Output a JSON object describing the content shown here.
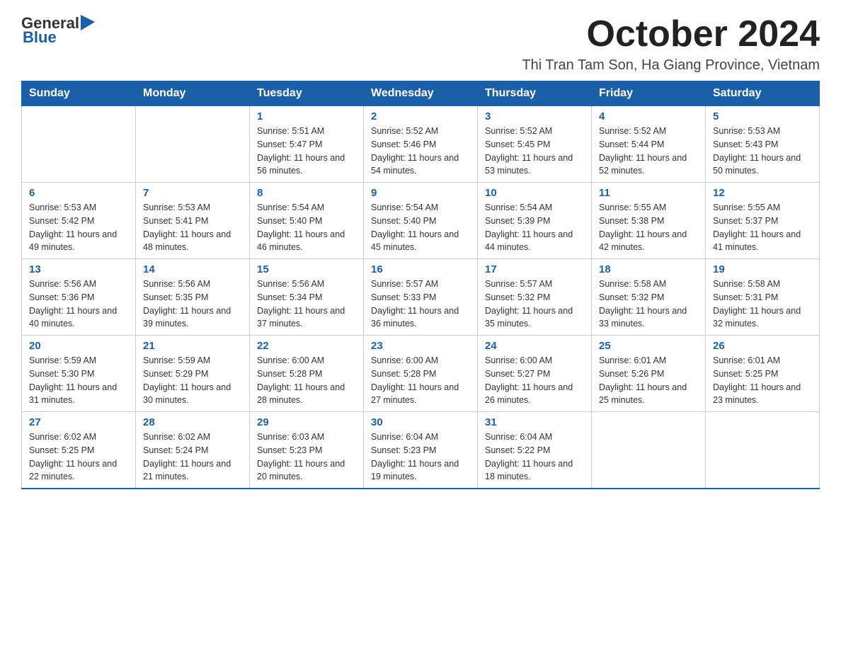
{
  "header": {
    "logo": {
      "general": "General",
      "blue": "Blue"
    },
    "title": "October 2024",
    "location": "Thi Tran Tam Son, Ha Giang Province, Vietnam"
  },
  "weekdays": [
    "Sunday",
    "Monday",
    "Tuesday",
    "Wednesday",
    "Thursday",
    "Friday",
    "Saturday"
  ],
  "weeks": [
    [
      {
        "day": "",
        "sunrise": "",
        "sunset": "",
        "daylight": ""
      },
      {
        "day": "",
        "sunrise": "",
        "sunset": "",
        "daylight": ""
      },
      {
        "day": "1",
        "sunrise": "Sunrise: 5:51 AM",
        "sunset": "Sunset: 5:47 PM",
        "daylight": "Daylight: 11 hours and 56 minutes."
      },
      {
        "day": "2",
        "sunrise": "Sunrise: 5:52 AM",
        "sunset": "Sunset: 5:46 PM",
        "daylight": "Daylight: 11 hours and 54 minutes."
      },
      {
        "day": "3",
        "sunrise": "Sunrise: 5:52 AM",
        "sunset": "Sunset: 5:45 PM",
        "daylight": "Daylight: 11 hours and 53 minutes."
      },
      {
        "day": "4",
        "sunrise": "Sunrise: 5:52 AM",
        "sunset": "Sunset: 5:44 PM",
        "daylight": "Daylight: 11 hours and 52 minutes."
      },
      {
        "day": "5",
        "sunrise": "Sunrise: 5:53 AM",
        "sunset": "Sunset: 5:43 PM",
        "daylight": "Daylight: 11 hours and 50 minutes."
      }
    ],
    [
      {
        "day": "6",
        "sunrise": "Sunrise: 5:53 AM",
        "sunset": "Sunset: 5:42 PM",
        "daylight": "Daylight: 11 hours and 49 minutes."
      },
      {
        "day": "7",
        "sunrise": "Sunrise: 5:53 AM",
        "sunset": "Sunset: 5:41 PM",
        "daylight": "Daylight: 11 hours and 48 minutes."
      },
      {
        "day": "8",
        "sunrise": "Sunrise: 5:54 AM",
        "sunset": "Sunset: 5:40 PM",
        "daylight": "Daylight: 11 hours and 46 minutes."
      },
      {
        "day": "9",
        "sunrise": "Sunrise: 5:54 AM",
        "sunset": "Sunset: 5:40 PM",
        "daylight": "Daylight: 11 hours and 45 minutes."
      },
      {
        "day": "10",
        "sunrise": "Sunrise: 5:54 AM",
        "sunset": "Sunset: 5:39 PM",
        "daylight": "Daylight: 11 hours and 44 minutes."
      },
      {
        "day": "11",
        "sunrise": "Sunrise: 5:55 AM",
        "sunset": "Sunset: 5:38 PM",
        "daylight": "Daylight: 11 hours and 42 minutes."
      },
      {
        "day": "12",
        "sunrise": "Sunrise: 5:55 AM",
        "sunset": "Sunset: 5:37 PM",
        "daylight": "Daylight: 11 hours and 41 minutes."
      }
    ],
    [
      {
        "day": "13",
        "sunrise": "Sunrise: 5:56 AM",
        "sunset": "Sunset: 5:36 PM",
        "daylight": "Daylight: 11 hours and 40 minutes."
      },
      {
        "day": "14",
        "sunrise": "Sunrise: 5:56 AM",
        "sunset": "Sunset: 5:35 PM",
        "daylight": "Daylight: 11 hours and 39 minutes."
      },
      {
        "day": "15",
        "sunrise": "Sunrise: 5:56 AM",
        "sunset": "Sunset: 5:34 PM",
        "daylight": "Daylight: 11 hours and 37 minutes."
      },
      {
        "day": "16",
        "sunrise": "Sunrise: 5:57 AM",
        "sunset": "Sunset: 5:33 PM",
        "daylight": "Daylight: 11 hours and 36 minutes."
      },
      {
        "day": "17",
        "sunrise": "Sunrise: 5:57 AM",
        "sunset": "Sunset: 5:32 PM",
        "daylight": "Daylight: 11 hours and 35 minutes."
      },
      {
        "day": "18",
        "sunrise": "Sunrise: 5:58 AM",
        "sunset": "Sunset: 5:32 PM",
        "daylight": "Daylight: 11 hours and 33 minutes."
      },
      {
        "day": "19",
        "sunrise": "Sunrise: 5:58 AM",
        "sunset": "Sunset: 5:31 PM",
        "daylight": "Daylight: 11 hours and 32 minutes."
      }
    ],
    [
      {
        "day": "20",
        "sunrise": "Sunrise: 5:59 AM",
        "sunset": "Sunset: 5:30 PM",
        "daylight": "Daylight: 11 hours and 31 minutes."
      },
      {
        "day": "21",
        "sunrise": "Sunrise: 5:59 AM",
        "sunset": "Sunset: 5:29 PM",
        "daylight": "Daylight: 11 hours and 30 minutes."
      },
      {
        "day": "22",
        "sunrise": "Sunrise: 6:00 AM",
        "sunset": "Sunset: 5:28 PM",
        "daylight": "Daylight: 11 hours and 28 minutes."
      },
      {
        "day": "23",
        "sunrise": "Sunrise: 6:00 AM",
        "sunset": "Sunset: 5:28 PM",
        "daylight": "Daylight: 11 hours and 27 minutes."
      },
      {
        "day": "24",
        "sunrise": "Sunrise: 6:00 AM",
        "sunset": "Sunset: 5:27 PM",
        "daylight": "Daylight: 11 hours and 26 minutes."
      },
      {
        "day": "25",
        "sunrise": "Sunrise: 6:01 AM",
        "sunset": "Sunset: 5:26 PM",
        "daylight": "Daylight: 11 hours and 25 minutes."
      },
      {
        "day": "26",
        "sunrise": "Sunrise: 6:01 AM",
        "sunset": "Sunset: 5:25 PM",
        "daylight": "Daylight: 11 hours and 23 minutes."
      }
    ],
    [
      {
        "day": "27",
        "sunrise": "Sunrise: 6:02 AM",
        "sunset": "Sunset: 5:25 PM",
        "daylight": "Daylight: 11 hours and 22 minutes."
      },
      {
        "day": "28",
        "sunrise": "Sunrise: 6:02 AM",
        "sunset": "Sunset: 5:24 PM",
        "daylight": "Daylight: 11 hours and 21 minutes."
      },
      {
        "day": "29",
        "sunrise": "Sunrise: 6:03 AM",
        "sunset": "Sunset: 5:23 PM",
        "daylight": "Daylight: 11 hours and 20 minutes."
      },
      {
        "day": "30",
        "sunrise": "Sunrise: 6:04 AM",
        "sunset": "Sunset: 5:23 PM",
        "daylight": "Daylight: 11 hours and 19 minutes."
      },
      {
        "day": "31",
        "sunrise": "Sunrise: 6:04 AM",
        "sunset": "Sunset: 5:22 PM",
        "daylight": "Daylight: 11 hours and 18 minutes."
      },
      {
        "day": "",
        "sunrise": "",
        "sunset": "",
        "daylight": ""
      },
      {
        "day": "",
        "sunrise": "",
        "sunset": "",
        "daylight": ""
      }
    ]
  ]
}
